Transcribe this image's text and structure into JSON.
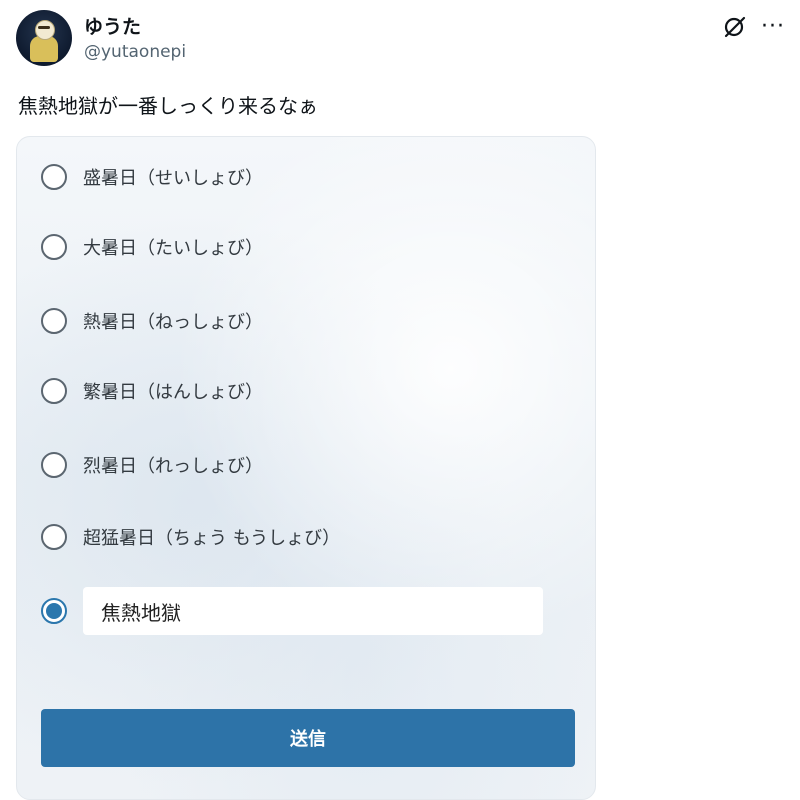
{
  "user": {
    "name": "ゆうた",
    "handle": "@yutaonepi",
    "avatar_icon": "avatar-figure-icon"
  },
  "header_actions": {
    "grok_icon": "grok-icon",
    "more_icon": "more-horizontal-icon",
    "more_glyph": "···"
  },
  "tweet": {
    "text": "焦熱地獄が一番しっくり来るなぁ"
  },
  "poll": {
    "options": [
      {
        "label": "盛暑日（せいしょび）",
        "selected": false
      },
      {
        "label": "大暑日（たいしょび）",
        "selected": false
      },
      {
        "label": "熱暑日（ねっしょび）",
        "selected": false
      },
      {
        "label": "繁暑日（はんしょび）",
        "selected": false
      },
      {
        "label": "烈暑日（れっしょび）",
        "selected": false
      },
      {
        "label": "超猛暑日（ちょう もうしょび）",
        "selected": false
      }
    ],
    "custom_option": {
      "selected": true,
      "value": "焦熱地獄"
    },
    "submit_label": "送信"
  },
  "colors": {
    "accent": "#2d73a8",
    "radio_selected": "#2b77ad"
  }
}
